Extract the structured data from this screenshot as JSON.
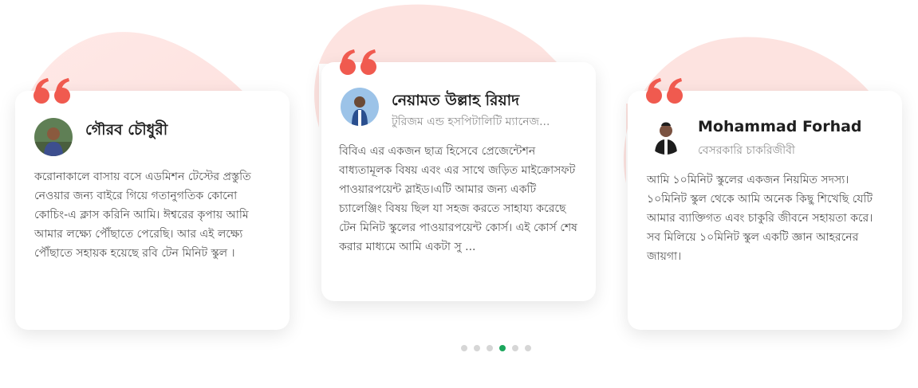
{
  "testimonials": [
    {
      "name": "গৌরব চৌধুরী",
      "role": "",
      "text": "করোনাকালে বাসায় বসে এডমিশন টেস্টের প্রস্তুতি নেওয়ার জন্য বাইরে গিয়ে গতানুগতিক কোনো কোচিং-এ ক্লাস করিনি আমি। ঈশ্বরের কৃপায় আমি আমার লক্ষ্যে পৌঁছাতে পেরেছি। আর এই লক্ষ্যে পৌঁছাতে সহায়ক হয়েছে রবি টেন মিনিট স্কুল ।"
    },
    {
      "name": "নেয়ামত উল্লাহ রিয়াদ",
      "role": "টুরিজম এন্ড হসপিটালিটি ম্যানেজ...",
      "text": "বিবিএ এর একজন ছাত্র হিসেবে প্রেজেন্টেশন বাধ্যতামূলক বিষয় এবং এর সাথে জড়িত মাইক্রোসফট পাওয়ারপয়েন্ট স্লাইড।এটি আমার জন্য একটি চ্যালেঞ্জিং বিষয় ছিল যা সহজ করতে সাহায্য করেছে টেন মিনিট স্কুলের পাওয়ারপয়েন্ট কোর্স। এই কোর্স শেষ করার মাধ্যমে আমি একটা সু ..."
    },
    {
      "name": "Mohammad Forhad",
      "role": "বেসরকারি চাকরিজীবী",
      "text": "আমি ১০মিনিট স্কুলের একজন নিয়মিত সদস্য। ১০মিনিট স্কুল থেকে আমি অনেক কিছু শিখেছি যেটি আমার ব্যাক্তিগত এবং চাকুরি জীবনে সহায়তা করে। সব মিলিয়ে ১০মিনিট স্কুল একটি জ্ঞান আহরনের জায়গা।"
    }
  ],
  "pagination": {
    "count": 6,
    "active": 3
  },
  "colors": {
    "quote": "#f05a4f",
    "blob": "#fde4e2",
    "active_dot": "#1ba65c",
    "dot": "#d6d6d6"
  }
}
